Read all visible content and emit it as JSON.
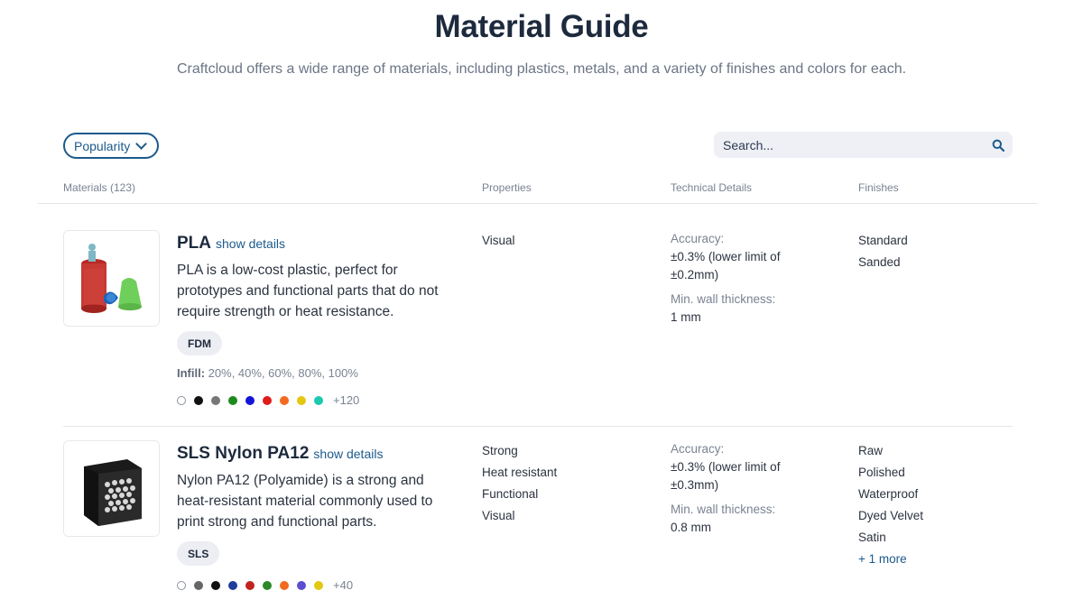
{
  "header": {
    "title": "Material Guide",
    "subtitle": "Craftcloud offers a wide range of materials, including plastics, metals, and a variety of finishes and colors for each."
  },
  "controls": {
    "sort_label": "Popularity",
    "search_placeholder": "Search..."
  },
  "columns": {
    "materials": "Materials (123)",
    "properties": "Properties",
    "technical": "Technical Details",
    "finishes": "Finishes"
  },
  "materials": [
    {
      "name": "PLA",
      "show_details": "show details",
      "description": "PLA is a low-cost plastic, perfect for prototypes and functional parts that do not require strength or heat resistance.",
      "technology": "FDM",
      "infill_label": "Infill:",
      "infill_values": "20%, 40%, 60%, 80%, 100%",
      "colors": [
        "#ffffff",
        "#111111",
        "#777777",
        "#1e8a1e",
        "#1414d6",
        "#e01b1b",
        "#f26a1f",
        "#e2c810",
        "#1cc9b0"
      ],
      "more_colors": "+120",
      "properties": [
        "Visual"
      ],
      "accuracy_label": "Accuracy:",
      "accuracy_value": "±0.3% (lower limit of ±0.2mm)",
      "wall_label": "Min. wall thickness:",
      "wall_value": "1 mm",
      "finishes": [
        "Standard",
        "Sanded"
      ]
    },
    {
      "name": "SLS Nylon PA12",
      "show_details": "show details",
      "description": "Nylon PA12 (Polyamide) is a strong and heat-resistant material commonly used to print strong and functional parts.",
      "technology": "SLS",
      "colors": [
        "#ffffff",
        "#666666",
        "#111111",
        "#1f3e9a",
        "#c0241f",
        "#2a8a2a",
        "#f26a1f",
        "#5a4fcf",
        "#e2c810"
      ],
      "more_colors": "+40",
      "properties": [
        "Strong",
        "Heat resistant",
        "Functional",
        "Visual"
      ],
      "accuracy_label": "Accuracy:",
      "accuracy_value": "±0.3% (lower limit of ±0.3mm)",
      "wall_label": "Min. wall thickness:",
      "wall_value": "0.8 mm",
      "finishes": [
        "Raw",
        "Polished",
        "Waterproof",
        "Dyed Velvet",
        "Satin"
      ],
      "finishes_more": "+ 1 more"
    }
  ]
}
